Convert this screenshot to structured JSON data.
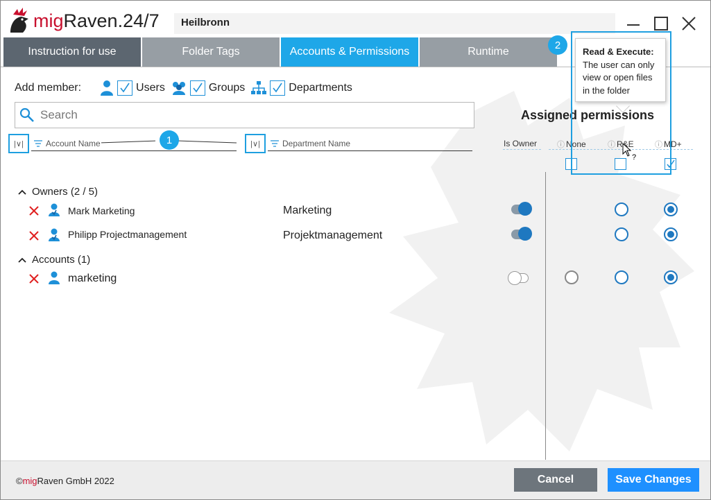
{
  "app": {
    "brand_prefix": "mig",
    "brand_suffix": "Raven.24/7",
    "location": "Heilbronn"
  },
  "window_controls": {
    "minimize": "minimize-icon",
    "maximize": "maximize-icon",
    "close": "close-icon"
  },
  "tabs": [
    {
      "label": "Instruction for use"
    },
    {
      "label": "Folder Tags"
    },
    {
      "label": "Accounts & Permissions"
    },
    {
      "label": "Runtime"
    }
  ],
  "add_member": {
    "label": "Add member:",
    "options": [
      {
        "label": "Users",
        "checked": true
      },
      {
        "label": "Groups",
        "checked": true
      },
      {
        "label": "Departments",
        "checked": true
      }
    ]
  },
  "search": {
    "placeholder": "Search"
  },
  "columns": {
    "account_name": "Account Name",
    "department_name": "Department Name",
    "sort_glyph": "|∨|"
  },
  "badges": {
    "one": "1",
    "two": "2"
  },
  "assigned": {
    "title": "Assigned permissions",
    "headers": {
      "is_owner": "Is Owner",
      "none": "None",
      "read_execute": "R&E",
      "modify_plus": "MD+"
    },
    "info_glyph": "ⓘ",
    "select_all": {
      "none": false,
      "read_execute": false,
      "modify_plus": true
    }
  },
  "tooltip": {
    "title": "Read & Execute:",
    "line1": "The user can only",
    "line2": "view or open files",
    "line3": "in the folder"
  },
  "groups": [
    {
      "label": "Owners (2 / 5)"
    },
    {
      "label": "Accounts (1)"
    }
  ],
  "rows": [
    {
      "name": "Mark Marketing",
      "department": "Marketing",
      "is_owner": true,
      "permission": "MD+"
    },
    {
      "name": "Philipp Projectmanagement",
      "department": "Projektmanagement",
      "is_owner": true,
      "permission": "MD+"
    },
    {
      "name": "marketing",
      "department": "",
      "is_owner": false,
      "permission": "MD+"
    }
  ],
  "footer": {
    "copyright_symbol": "©",
    "copyright_brand": "mig",
    "copyright_rest": "Raven GmbH 2022",
    "cancel": "Cancel",
    "save": "Save Changes"
  },
  "colors": {
    "accent": "#1ea7e8",
    "brand_red": "#c8102e",
    "save": "#1e90ff",
    "cancel": "#6d757c"
  }
}
